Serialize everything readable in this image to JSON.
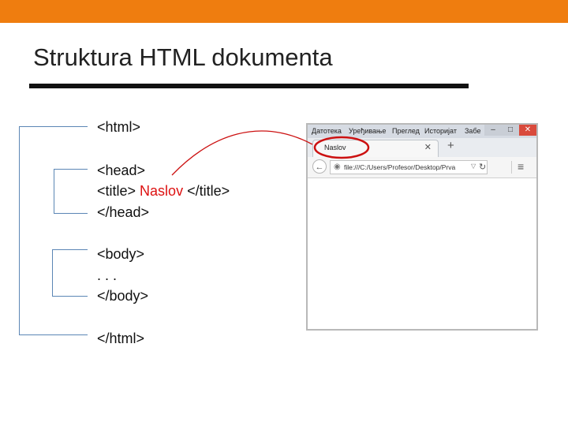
{
  "slide": {
    "title": "Struktura HTML dokumenta",
    "accent": "#ef7d0f"
  },
  "code": {
    "html_open": "<html>",
    "head_open": "<head>",
    "title_open": "<title> ",
    "title_text": "Naslov",
    "title_close": " </title>",
    "head_close": "</head>",
    "body_open": "<body>",
    "ellipsis": ". . .",
    "body_close": "</body>",
    "html_close": "</html>"
  },
  "browser": {
    "menu": [
      "Датотека",
      "Уређивање",
      "Преглед",
      "Историјат",
      "Забе"
    ],
    "tab_title": "Naslov",
    "url": "file:///C:/Users/Profesor/Desktop/Prva",
    "icons": [
      "minimize-icon",
      "maximize-icon",
      "close-icon",
      "back-icon",
      "globe-icon",
      "reload-icon",
      "menu-icon",
      "plus-icon"
    ],
    "highlight_color": "#d11"
  }
}
